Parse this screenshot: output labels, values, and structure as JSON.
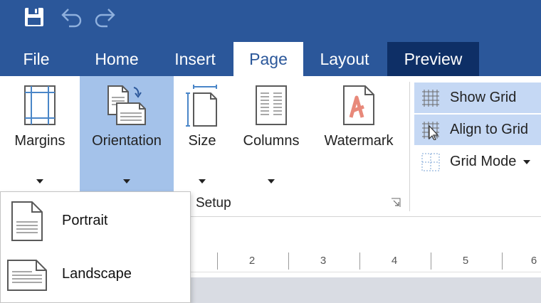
{
  "quick_access": {
    "save_icon": "save-icon",
    "undo_icon": "undo-icon",
    "redo_icon": "redo-icon"
  },
  "tabs": [
    {
      "label": "File"
    },
    {
      "label": "Home"
    },
    {
      "label": "Insert"
    },
    {
      "label": "Page"
    },
    {
      "label": "Layout"
    },
    {
      "label": "Preview"
    }
  ],
  "ribbon": {
    "margins": "Margins",
    "orientation": "Orientation",
    "size": "Size",
    "columns": "Columns",
    "watermark": "Watermark",
    "group_label": "Setup",
    "show_grid": "Show Grid",
    "align_to_grid": "Align to Grid",
    "grid_mode": "Grid Mode"
  },
  "ruler": {
    "numbers": [
      "2",
      "3",
      "4",
      "5",
      "6"
    ]
  },
  "orientation_menu": {
    "items": [
      {
        "label": "Portrait"
      },
      {
        "label": "Landscape"
      }
    ]
  },
  "colors": {
    "titlebar": "#2b579a",
    "preview_tab": "#0e2f66",
    "selected_button": "#a4c2ea",
    "toggle_on": "#c5d8f4"
  }
}
